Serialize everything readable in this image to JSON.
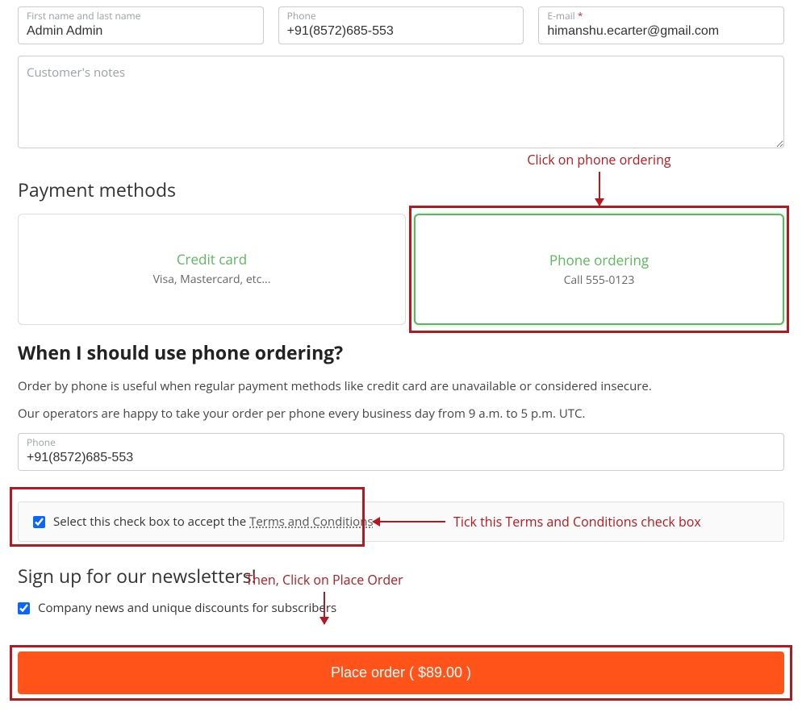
{
  "fields": {
    "name_label": "First name and last name",
    "name_value": "Admin Admin",
    "phone_label": "Phone",
    "phone_value": "+91(8572)685-553",
    "email_label": "E-mail",
    "email_required_marker": "*",
    "email_value": "himanshu.ecarter@gmail.com",
    "notes_placeholder": "Customer's notes"
  },
  "payment": {
    "heading": "Payment methods",
    "credit": {
      "title": "Credit card",
      "sub": "Visa, Mastercard, etc..."
    },
    "phone": {
      "title": "Phone ordering",
      "sub": "Call 555-0123"
    }
  },
  "phone_ordering": {
    "heading": "When I should use phone ordering?",
    "line1": "Order by phone is useful when regular payment methods like credit card are unavailable or considered insecure.",
    "line2": "Our operators are happy to take your order per phone every business day from 9 a.m. to 5 p.m. UTC.",
    "phone_label": "Phone",
    "phone_value": "+91(8572)685-553"
  },
  "terms": {
    "label_prefix": "Select this check box to accept the ",
    "link_text": "Terms and Conditions"
  },
  "newsletter": {
    "heading": "Sign up for our newsletters!",
    "option": "Company news and unique discounts for subscribers"
  },
  "place_order": {
    "label": "Place order ( $89.00 )"
  },
  "annotations": {
    "phone_click": "Click on phone ordering",
    "terms_tick": "Tick this Terms and Conditions check box",
    "place_click": "Then, Click on Place Order"
  }
}
